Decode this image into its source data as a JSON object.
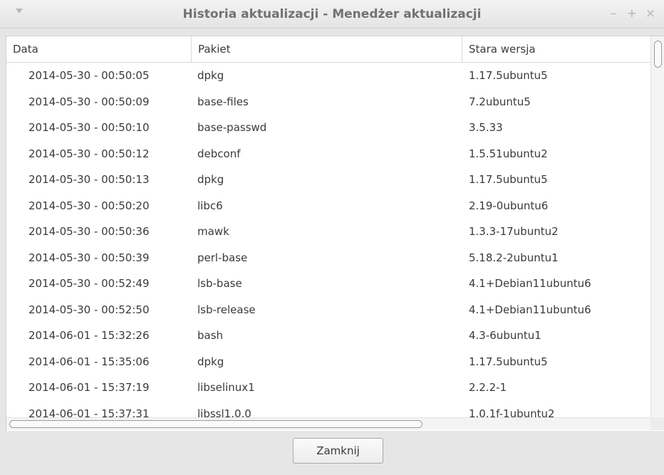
{
  "window": {
    "title": "Historia aktualizacji - Menedżer aktualizacji",
    "menu_icon": "triangle-down-icon",
    "controls": {
      "minimize": "–",
      "maximize": "+",
      "close": "×"
    }
  },
  "table": {
    "columns": [
      "Data",
      "Pakiet",
      "Stara wersja"
    ],
    "rows": [
      {
        "date": "2014-05-30 - 00:50:05",
        "package": "dpkg",
        "old_version": "1.17.5ubuntu5"
      },
      {
        "date": "2014-05-30 - 00:50:09",
        "package": "base-files",
        "old_version": "7.2ubuntu5"
      },
      {
        "date": "2014-05-30 - 00:50:10",
        "package": "base-passwd",
        "old_version": "3.5.33"
      },
      {
        "date": "2014-05-30 - 00:50:12",
        "package": "debconf",
        "old_version": "1.5.51ubuntu2"
      },
      {
        "date": "2014-05-30 - 00:50:13",
        "package": "dpkg",
        "old_version": "1.17.5ubuntu5"
      },
      {
        "date": "2014-05-30 - 00:50:20",
        "package": "libc6",
        "old_version": "2.19-0ubuntu6"
      },
      {
        "date": "2014-05-30 - 00:50:36",
        "package": "mawk",
        "old_version": "1.3.3-17ubuntu2"
      },
      {
        "date": "2014-05-30 - 00:50:39",
        "package": "perl-base",
        "old_version": "5.18.2-2ubuntu1"
      },
      {
        "date": "2014-05-30 - 00:52:49",
        "package": "lsb-base",
        "old_version": "4.1+Debian11ubuntu6"
      },
      {
        "date": "2014-05-30 - 00:52:50",
        "package": "lsb-release",
        "old_version": "4.1+Debian11ubuntu6"
      },
      {
        "date": "2014-06-01 - 15:32:26",
        "package": "bash",
        "old_version": "4.3-6ubuntu1"
      },
      {
        "date": "2014-06-01 - 15:35:06",
        "package": "dpkg",
        "old_version": "1.17.5ubuntu5"
      },
      {
        "date": "2014-06-01 - 15:37:19",
        "package": "libselinux1",
        "old_version": "2.2.2-1"
      },
      {
        "date": "2014-06-01 - 15:37:31",
        "package": "libssl1.0.0",
        "old_version": "1.0.1f-1ubuntu2"
      }
    ]
  },
  "footer": {
    "close_label": "Zamknij"
  }
}
